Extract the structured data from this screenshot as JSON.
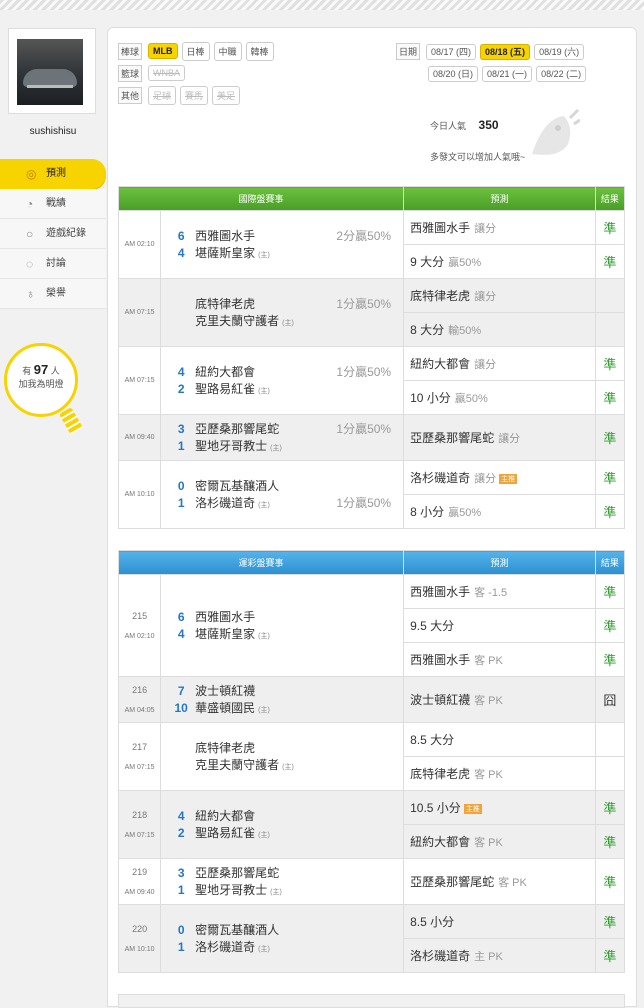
{
  "sidebar": {
    "username": "sushishisu",
    "menu": [
      {
        "label": "預測",
        "icon": "target-icon",
        "active": true
      },
      {
        "label": "戰績",
        "icon": "chart-icon"
      },
      {
        "label": "遊戲紀錄",
        "icon": "history-icon"
      },
      {
        "label": "討論",
        "icon": "chat-icon"
      },
      {
        "label": "榮譽",
        "icon": "medal-icon"
      }
    ],
    "lamp": {
      "prefix": "有",
      "count": "97",
      "suffix": "人",
      "line2": "加我為明燈"
    }
  },
  "filters": {
    "rows": [
      {
        "label": "棒球",
        "items": [
          "MLB",
          "日棒",
          "中職",
          "韓棒"
        ],
        "selected": "MLB"
      },
      {
        "label": "籃球",
        "items": [
          "WNBA"
        ],
        "disabled": [
          "WNBA"
        ]
      },
      {
        "label": "其他",
        "items": [
          "足球",
          "賽馬",
          "美足"
        ],
        "disabled": [
          "足球",
          "賽馬",
          "美足"
        ]
      }
    ],
    "date_label": "日期",
    "dates_row1": [
      "08/17 (四)",
      "08/18 (五)",
      "08/19 (六)"
    ],
    "dates_row2": [
      "08/20 (日)",
      "08/21 (一)",
      "08/22 (二)"
    ],
    "selected_date": "08/18 (五)"
  },
  "popularity": {
    "label": "今日人氣",
    "value": "350",
    "hint": "多發文可以增加人氣哦~"
  },
  "intl": {
    "headers": [
      "國際盤賽事",
      "預測",
      "結果"
    ],
    "games": [
      {
        "time": "AM 02:10",
        "away": "西雅圖水手",
        "away_score": "6",
        "home": "堪薩斯皇家",
        "home_score": "4",
        "spread": "2分贏50%",
        "spread_row": 0,
        "preds": [
          {
            "main": "西雅圖水手",
            "sub": "讓分",
            "result": "準"
          },
          {
            "main": "9 大分",
            "sub": "贏50%",
            "result": "準"
          }
        ]
      },
      {
        "time": "AM 07:15",
        "away": "底特律老虎",
        "away_score": "",
        "home": "克里夫蘭守護者",
        "home_score": "",
        "spread": "1分贏50%",
        "spread_row": 0,
        "preds": [
          {
            "main": "底特律老虎",
            "sub": "讓分",
            "result": ""
          },
          {
            "main": "8 大分",
            "sub": "輸50%",
            "result": ""
          }
        ]
      },
      {
        "time": "AM 07:15",
        "away": "紐約大都會",
        "away_score": "4",
        "home": "聖路易紅雀",
        "home_score": "2",
        "spread": "1分贏50%",
        "spread_row": 0,
        "preds": [
          {
            "main": "紐約大都會",
            "sub": "讓分",
            "result": "準"
          },
          {
            "main": "10 小分",
            "sub": "贏50%",
            "result": "準"
          }
        ]
      },
      {
        "time": "AM 09:40",
        "away": "亞歷桑那響尾蛇",
        "away_score": "3",
        "home": "聖地牙哥教士",
        "home_score": "1",
        "spread": "1分贏50%",
        "spread_row": 0,
        "preds": [
          {
            "main": "亞歷桑那響尾蛇",
            "sub": "讓分",
            "result": "準"
          }
        ]
      },
      {
        "time": "AM 10:10",
        "away": "密爾瓦基釀酒人",
        "away_score": "0",
        "home": "洛杉磯道奇",
        "home_score": "1",
        "spread": "1分贏50%",
        "spread_row": 1,
        "preds": [
          {
            "main": "洛杉磯道奇",
            "sub": "讓分",
            "badge": "主推",
            "result": "準"
          },
          {
            "main": "8 小分",
            "sub": "贏50%",
            "result": "準"
          }
        ]
      }
    ]
  },
  "sports_lottery": {
    "headers": [
      "運彩盤賽事",
      "預測",
      "結果"
    ],
    "games": [
      {
        "id": "215",
        "time": "AM 02:10",
        "away": "西雅圖水手",
        "away_score": "6",
        "home": "堪薩斯皇家",
        "home_score": "4",
        "preds": [
          {
            "main": "西雅圖水手",
            "sub": "客 -1.5",
            "result": "準"
          },
          {
            "main": "9.5 大分",
            "sub": "",
            "result": "準"
          },
          {
            "main": "西雅圖水手",
            "sub": "客 PK",
            "result": "準"
          }
        ]
      },
      {
        "id": "216",
        "time": "AM 04:05",
        "away": "波士頓紅襪",
        "away_score": "7",
        "home": "華盛頓國民",
        "home_score": "10",
        "preds": [
          {
            "main": "波士頓紅襪",
            "sub": "客 PK",
            "result": "囧"
          }
        ]
      },
      {
        "id": "217",
        "time": "AM 07:15",
        "away": "底特律老虎",
        "away_score": "",
        "home": "克里夫蘭守護者",
        "home_score": "",
        "preds": [
          {
            "main": "8.5 大分",
            "sub": "",
            "result": ""
          },
          {
            "main": "底特律老虎",
            "sub": "客 PK",
            "result": ""
          }
        ]
      },
      {
        "id": "218",
        "time": "AM 07:15",
        "away": "紐約大都會",
        "away_score": "4",
        "home": "聖路易紅雀",
        "home_score": "2",
        "preds": [
          {
            "main": "10.5 小分",
            "sub": "",
            "badge": "主推",
            "result": "準"
          },
          {
            "main": "紐約大都會",
            "sub": "客 PK",
            "result": "準"
          }
        ]
      },
      {
        "id": "219",
        "time": "AM 09:40",
        "away": "亞歷桑那響尾蛇",
        "away_score": "3",
        "home": "聖地牙哥教士",
        "home_score": "1",
        "preds": [
          {
            "main": "亞歷桑那響尾蛇",
            "sub": "客 PK",
            "result": "準"
          }
        ]
      },
      {
        "id": "220",
        "time": "AM 10:10",
        "away": "密爾瓦基釀酒人",
        "away_score": "0",
        "home": "洛杉磯道奇",
        "home_score": "1",
        "preds": [
          {
            "main": "8.5 小分",
            "sub": "",
            "result": "準"
          },
          {
            "main": "洛杉磯道奇",
            "sub": "主 PK",
            "result": "準"
          }
        ]
      }
    ]
  },
  "home_marker": "(主)",
  "colors": {
    "accent": "#f7d300",
    "green_header": "#4a9d26",
    "blue_header": "#2c8fd0",
    "result_green": "#2aa12a",
    "score_blue": "#2377c5"
  }
}
